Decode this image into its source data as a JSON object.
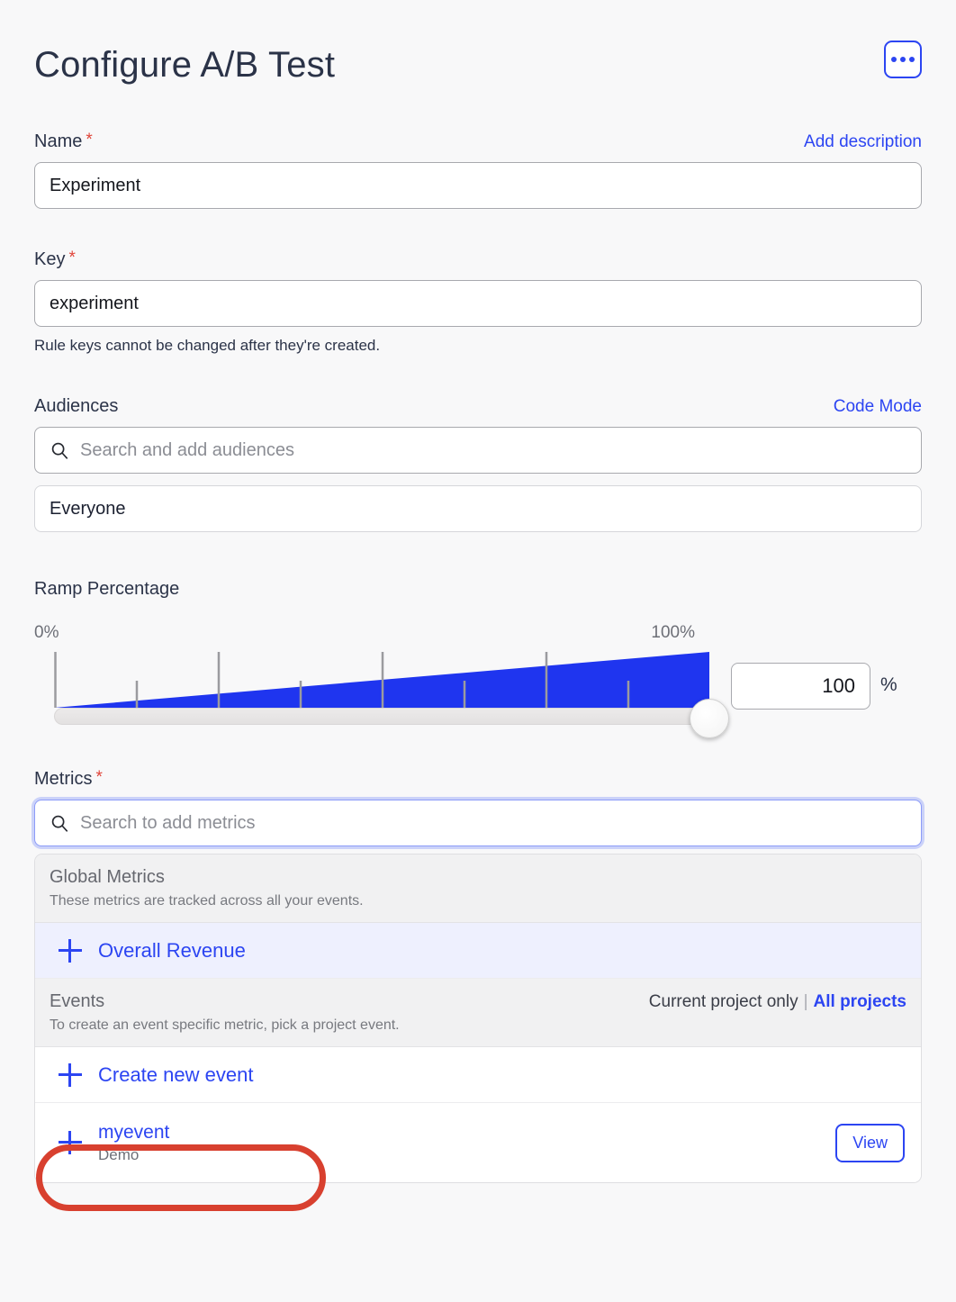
{
  "header": {
    "title": "Configure A/B Test",
    "more_button": "more-options"
  },
  "name_field": {
    "label": "Name",
    "required_marker": "*",
    "action_link": "Add description",
    "value": "Experiment"
  },
  "key_field": {
    "label": "Key",
    "required_marker": "*",
    "value": "experiment",
    "helper": "Rule keys cannot be changed after they're created."
  },
  "audiences": {
    "label": "Audiences",
    "action_link": "Code Mode",
    "search_placeholder": "Search and add audiences",
    "search_value": "",
    "items": [
      {
        "label": "Everyone"
      }
    ]
  },
  "ramp": {
    "label": "Ramp Percentage",
    "min_label": "0%",
    "max_label": "100%",
    "value": "100",
    "unit": "%",
    "fill_color": "#1f35ef",
    "tick_count": 9
  },
  "metrics": {
    "label": "Metrics",
    "required_marker": "*",
    "search_placeholder": "Search to add metrics",
    "search_value": "",
    "groups": [
      {
        "title": "Global Metrics",
        "subtitle": "These metrics are tracked across all your events.",
        "options": [
          {
            "label": "Overall Revenue",
            "icon": "plus-icon",
            "highlighted": true
          }
        ]
      },
      {
        "title": "Events",
        "subtitle": "To create an event specific metric, pick a project event.",
        "scope_current": "Current project only",
        "scope_separator": "|",
        "scope_all": "All projects",
        "options": [
          {
            "label": "Create new event",
            "icon": "plus-icon",
            "highlighted": false
          },
          {
            "label": "myevent",
            "sublabel": "Demo",
            "icon": "plus-icon",
            "action": "View"
          }
        ]
      }
    ]
  },
  "annotation": {
    "color": "#d8402f",
    "target": "Create new event"
  },
  "colors": {
    "accent_blue": "#2c45f2",
    "required_red": "#e0453a",
    "page_bg": "#f8f8f9",
    "highlight_row": "#eef0fe",
    "group_header_bg": "#f1f1f2"
  }
}
